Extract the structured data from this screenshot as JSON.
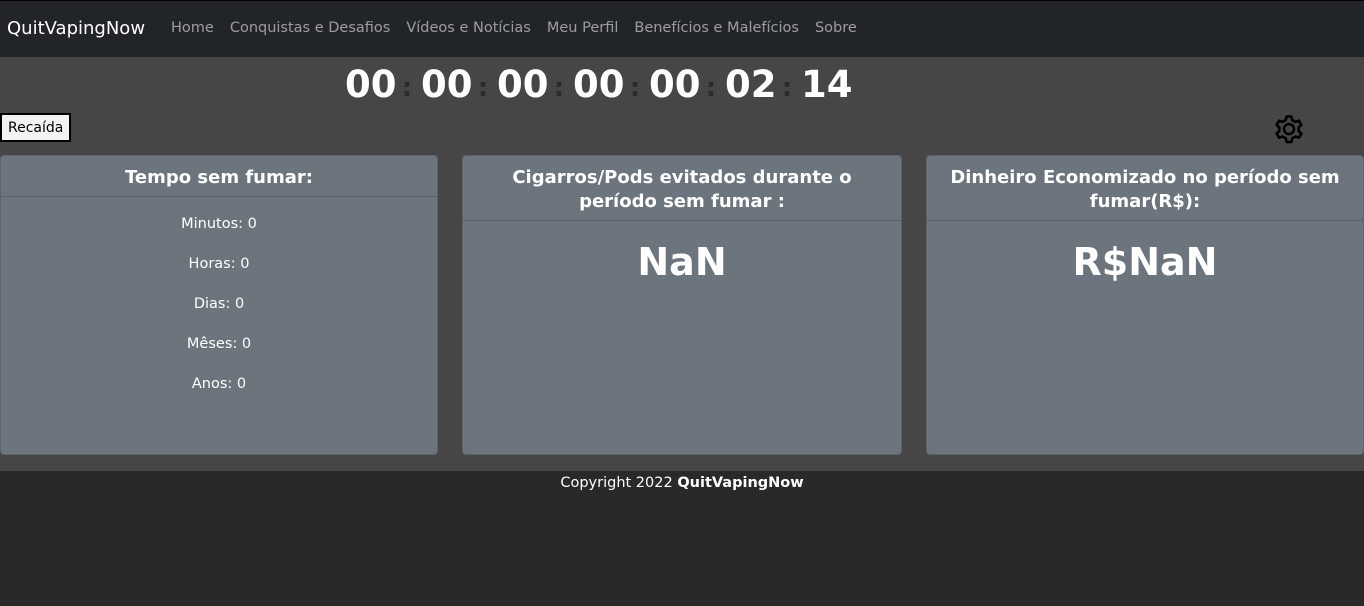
{
  "navbar": {
    "brand": "QuitVapingNow",
    "links": [
      "Home",
      "Conquistas e Desafios",
      "Vídeos e Notícias",
      "Meu Perfil",
      "Benefícios e Malefícios",
      "Sobre"
    ]
  },
  "timer": {
    "units": [
      "00",
      "00",
      "00",
      "00",
      "00",
      "02",
      "14"
    ],
    "separator": ":"
  },
  "relapse_button": "Recaída",
  "settings_icon": "gear-icon",
  "cards": {
    "time": {
      "title": "Tempo sem fumar:",
      "stats": [
        "Minutos: 0",
        "Horas: 0",
        "Dias: 0",
        "Mêses: 0",
        "Anos: 0"
      ]
    },
    "cigarettes": {
      "title": "Cigarros/Pods evitados durante o período sem fumar :",
      "value": "NaN"
    },
    "money": {
      "title": "Dinheiro Economizado no período sem fumar(R$):",
      "value": "R$NaN"
    }
  },
  "footer": {
    "text": "Copyright 2022",
    "brand": "QuitVapingNow"
  },
  "colors": {
    "navbar": "#212529",
    "main_bg": "#474546",
    "card_bg": "#6c757d",
    "page_bg": "#2a2829"
  }
}
